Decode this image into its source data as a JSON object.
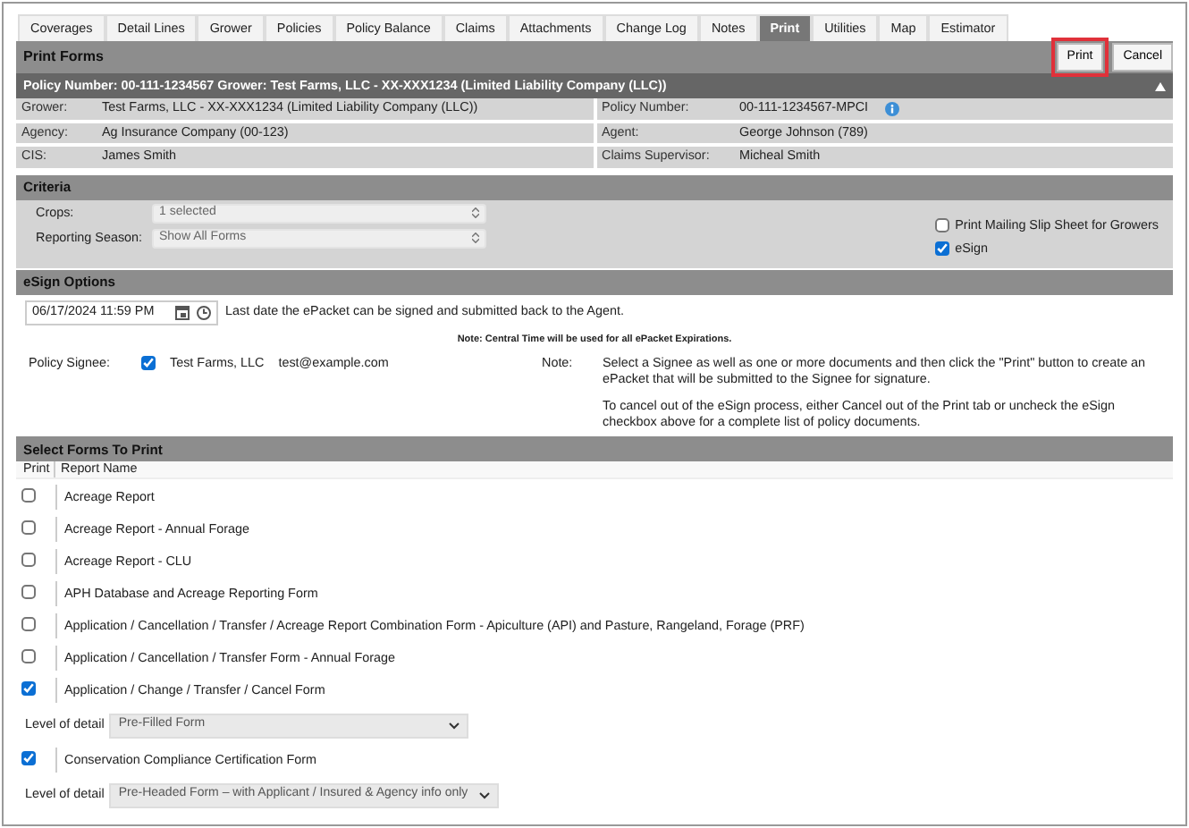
{
  "tabs": [
    {
      "label": "Coverages",
      "selected": false
    },
    {
      "label": "Detail Lines",
      "selected": false
    },
    {
      "label": "Grower",
      "selected": false
    },
    {
      "label": "Policies",
      "selected": false
    },
    {
      "label": "Policy Balance",
      "selected": false
    },
    {
      "label": "Claims",
      "selected": false
    },
    {
      "label": "Attachments",
      "selected": false
    },
    {
      "label": "Change Log",
      "selected": false
    },
    {
      "label": "Notes",
      "selected": false
    },
    {
      "label": "Print",
      "selected": true
    },
    {
      "label": "Utilities",
      "selected": false
    },
    {
      "label": "Map",
      "selected": false
    },
    {
      "label": "Estimator",
      "selected": false
    }
  ],
  "panel": {
    "title": "Print Forms",
    "buttons": [
      {
        "label": "Print",
        "highlighted": true
      },
      {
        "label": "Cancel",
        "highlighted": false
      }
    ]
  },
  "policy_bar": {
    "text": "Policy Number: 00-111-1234567 Grower: Test Farms, LLC - XX-XXX1234 (Limited Liability Company (LLC))",
    "expanded": true
  },
  "policy_info": [
    [
      {
        "label": "Grower:",
        "value": "Test Farms, LLC - XX-XXX1234 (Limited Liability Company (LLC))",
        "info": false
      },
      {
        "label": "Policy Number:",
        "value": "00-111-1234567-MPCI",
        "info": true
      }
    ],
    [
      {
        "label": "Agency:",
        "value": "Ag Insurance Company (00-123)",
        "info": false
      },
      {
        "label": "Agent:",
        "value": "George Johnson (789)",
        "info": false
      }
    ],
    [
      {
        "label": "CIS:",
        "value": "James Smith",
        "info": false
      },
      {
        "label": "Claims Supervisor:",
        "value": "Micheal Smith",
        "info": false
      }
    ]
  ],
  "criteria": {
    "title": "Criteria",
    "selects": [
      {
        "label": "Crops:",
        "value": "1 selected"
      },
      {
        "label": "Reporting Season:",
        "value": "Show All Forms"
      }
    ],
    "checkboxes": [
      {
        "label": "Print Mailing Slip Sheet for Growers",
        "checked": false
      },
      {
        "label": "eSign",
        "checked": true
      }
    ]
  },
  "esign": {
    "title": "eSign Options",
    "date": "06/17/2024 11:59 PM",
    "date_hint": "Last date the ePacket can be signed and submitted back to the Agent.",
    "central_note": "Note: Central Time will be used for all ePacket Expirations.",
    "signee": {
      "label": "Policy Signee:",
      "checked": true,
      "name": "Test Farms, LLC",
      "email": "test@example.com"
    },
    "note": {
      "label": "Note:",
      "paragraphs": [
        "Select a Signee as well as one or more documents and then click the \"Print\" button to create an ePacket that will be submitted to the Signee for signature.",
        "To cancel out of the eSign process, either Cancel out of the Print tab or uncheck the eSign checkbox above for a complete list of policy documents."
      ]
    }
  },
  "forms": {
    "title": "Select Forms To Print",
    "columns": [
      "Print",
      "Report Name"
    ],
    "rows": [
      {
        "kind": "form",
        "name": "Acreage Report",
        "checked": false
      },
      {
        "kind": "form",
        "name": "Acreage Report - Annual Forage",
        "checked": false
      },
      {
        "kind": "form",
        "name": "Acreage Report - CLU",
        "checked": false
      },
      {
        "kind": "form",
        "name": "APH Database and Acreage Reporting Form",
        "checked": false
      },
      {
        "kind": "form",
        "name": "Application / Cancellation / Transfer / Acreage Report Combination Form - Apiculture (API) and Pasture, Rangeland, Forage (PRF)",
        "checked": false
      },
      {
        "kind": "form",
        "name": "Application / Cancellation / Transfer Form - Annual Forage",
        "checked": false
      },
      {
        "kind": "form",
        "name": "Application / Change / Transfer / Cancel Form",
        "checked": true
      },
      {
        "kind": "detail",
        "label": "Level of detail",
        "value": "Pre-Filled Form"
      },
      {
        "kind": "form",
        "name": "Conservation Compliance Certification Form",
        "checked": true
      },
      {
        "kind": "detail",
        "label": "Level of detail",
        "value": "Pre-Headed Form – with Applicant / Insured & Agency info only"
      }
    ]
  }
}
